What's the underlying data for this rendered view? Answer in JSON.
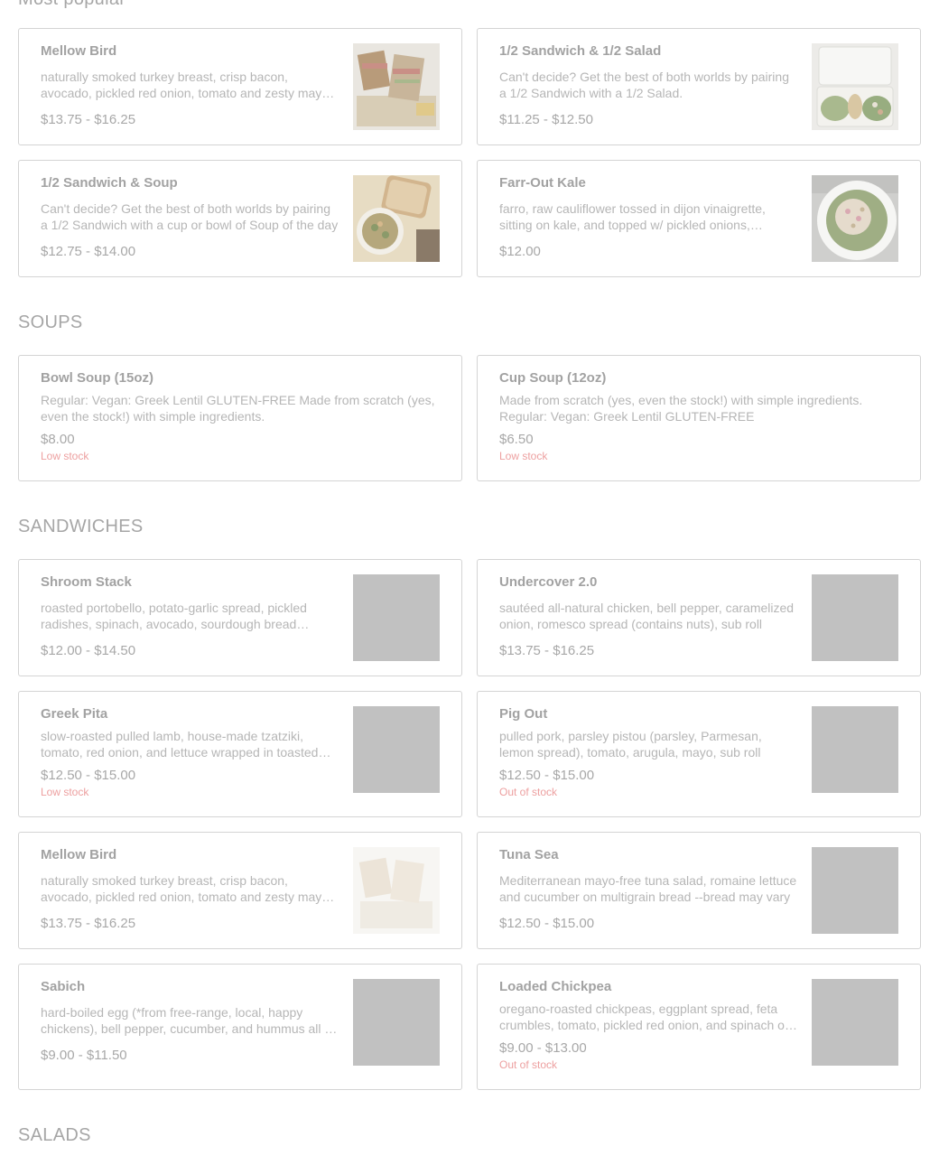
{
  "sections": {
    "popular": "Most popular",
    "soups": "SOUPS",
    "sandwiches": "SANDWICHES",
    "salads": "SALADS"
  },
  "popular": [
    {
      "name": "Mellow Bird",
      "desc": "naturally smoked turkey breast, crisp bacon, avocado, pickled red onion, tomato and zesty mayo on multigrain bread",
      "price": "$13.75 - $16.25",
      "image": "sandwich-photo"
    },
    {
      "name": "1/2 Sandwich & 1/2 Salad",
      "desc": "Can't decide? Get the best of both worlds by pairing a 1/2 Sandwich with a 1/2 Salad.",
      "price": "$11.25 - $12.50",
      "image": "salad-box-photo"
    },
    {
      "name": "1/2 Sandwich & Soup",
      "desc": "Can't decide? Get the best of both worlds by pairing a 1/2 Sandwich with a cup or bowl of Soup of the day",
      "price": "$12.75 - $14.00",
      "image": "soup-and-sandwich-photo"
    },
    {
      "name": "Farr-Out Kale",
      "desc": "farro, raw cauliflower tossed in dijon vinaigrette, sitting on kale, and topped w/ pickled onions, parmesan and sunflower seeds",
      "price": "$12.00",
      "image": "kale-salad-photo"
    }
  ],
  "soups": [
    {
      "name": "Bowl Soup (15oz)",
      "desc": "Regular: Vegan: Greek Lentil GLUTEN-FREE Made from scratch (yes, even the stock!) with simple ingredients.",
      "price": "$8.00",
      "stock": "Low stock"
    },
    {
      "name": "Cup Soup (12oz)",
      "desc": "Made from scratch (yes, even the stock!) with simple ingredients. Regular: Vegan: Greek Lentil GLUTEN-FREE",
      "price": "$6.50",
      "stock": "Low stock"
    }
  ],
  "sandwiches": [
    {
      "name": "Shroom Stack",
      "desc": "roasted portobello, potato-garlic spread, pickled radishes, spinach, avocado, sourdough bread (contains nuts)",
      "price": "$12.00 - $14.50",
      "stock": ""
    },
    {
      "name": "Undercover 2.0",
      "desc": "sautéed all-natural chicken, bell pepper, caramelized onion, romesco spread (contains nuts), sub roll",
      "price": "$13.75 - $16.25",
      "stock": ""
    },
    {
      "name": "Greek Pita",
      "desc": "slow-roasted pulled lamb, house-made tzatziki, tomato, red onion, and lettuce wrapped in toasted pita",
      "price": "$12.50 - $15.00",
      "stock": "Low stock"
    },
    {
      "name": "Pig Out",
      "desc": "pulled pork, parsley pistou (parsley, Parmesan, lemon spread), tomato, arugula, mayo, sub roll",
      "price": "$12.50 - $15.00",
      "stock": "Out of stock"
    },
    {
      "name": "Mellow Bird",
      "desc": "naturally smoked turkey breast, crisp bacon, avocado, pickled red onion, tomato and zesty mayo on multigrain bread",
      "price": "$13.75 - $16.25",
      "stock": ""
    },
    {
      "name": "Tuna Sea",
      "desc": "Mediterranean mayo-free tuna salad, romaine lettuce and cucumber on multigrain bread --bread may vary",
      "price": "$12.50 - $15.00",
      "stock": ""
    },
    {
      "name": "Sabich",
      "desc": "hard-boiled egg (*from free-range, local, happy chickens), bell pepper, cucumber, and hummus all in a toasted pita",
      "price": "$9.00 - $11.50",
      "stock": ""
    },
    {
      "name": "Loaded Chickpea",
      "desc": "oregano-roasted chickpeas, eggplant spread, feta crumbles, tomato, pickled red onion, and spinach on sub roll",
      "price": "$9.00 - $13.00",
      "stock": "Out of stock"
    }
  ],
  "colors": {
    "out_of_stock": "#eda0a0",
    "placeholder": "#c1c1c1",
    "border": "#d4d4d4"
  }
}
